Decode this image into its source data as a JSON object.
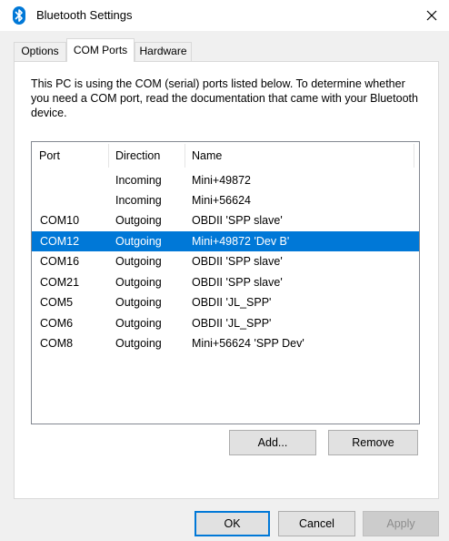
{
  "window": {
    "title": "Bluetooth Settings"
  },
  "tabs": [
    {
      "label": "Options"
    },
    {
      "label": "COM Ports"
    },
    {
      "label": "Hardware"
    }
  ],
  "description": "This PC is using the COM (serial) ports listed below. To determine whether you need a COM port, read the documentation that came with your Bluetooth device.",
  "table": {
    "columns": [
      "Port",
      "Direction",
      "Name"
    ],
    "rows": [
      {
        "port": "",
        "direction": "Incoming",
        "name": "Mini+49872"
      },
      {
        "port": "",
        "direction": "Incoming",
        "name": "Mini+56624"
      },
      {
        "port": "COM10",
        "direction": "Outgoing",
        "name": "OBDII 'SPP slave'"
      },
      {
        "port": "COM12",
        "direction": "Outgoing",
        "name": "Mini+49872 'Dev B'"
      },
      {
        "port": "COM16",
        "direction": "Outgoing",
        "name": "OBDII 'SPP slave'"
      },
      {
        "port": "COM21",
        "direction": "Outgoing",
        "name": "OBDII 'SPP slave'"
      },
      {
        "port": "COM5",
        "direction": "Outgoing",
        "name": "OBDII 'JL_SPP'"
      },
      {
        "port": "COM6",
        "direction": "Outgoing",
        "name": "OBDII 'JL_SPP'"
      },
      {
        "port": "COM8",
        "direction": "Outgoing",
        "name": "Mini+56624 'SPP Dev'"
      }
    ]
  },
  "buttons": {
    "add": "Add...",
    "remove": "Remove",
    "ok": "OK",
    "cancel": "Cancel",
    "apply": "Apply"
  },
  "colors": {
    "selection": "#0078d7",
    "bluetooth_icon": "#0078d7",
    "dialog_background": "#f0f0f0"
  },
  "icons": {
    "app": "bluetooth-icon",
    "close": "close-icon"
  }
}
